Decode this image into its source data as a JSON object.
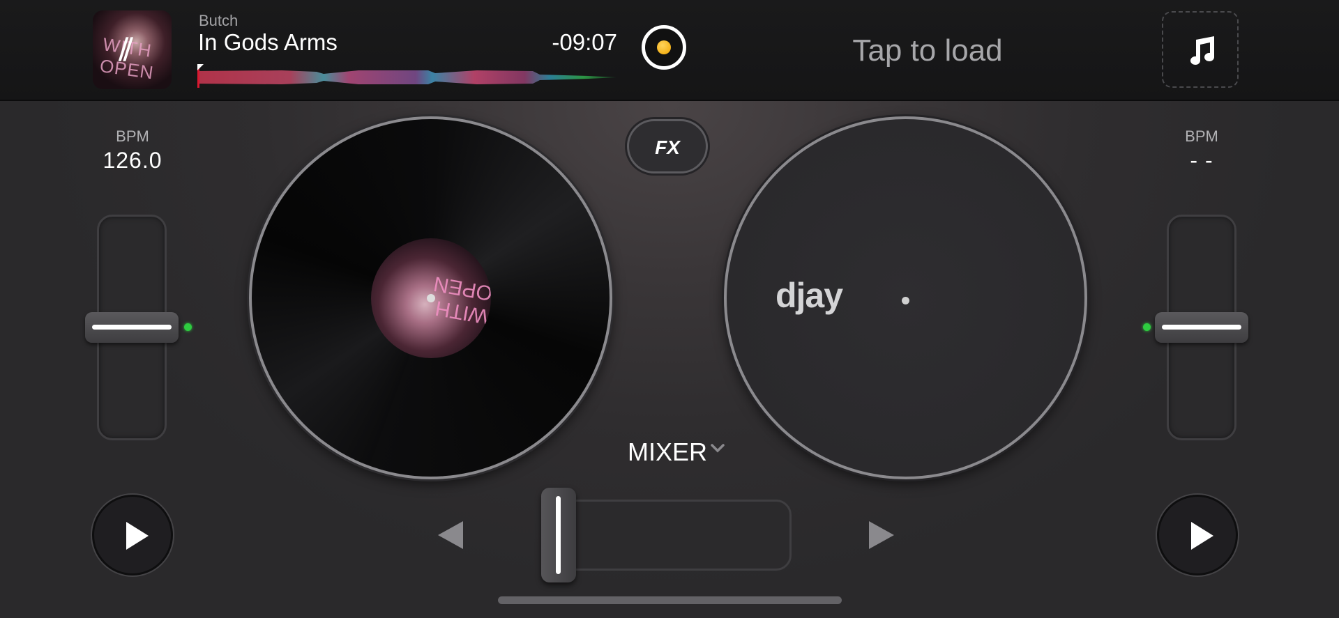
{
  "deck_left": {
    "artist": "Butch",
    "title": "In Gods Arms",
    "time_remaining": "-09:07",
    "bpm_label": "BPM",
    "bpm_value": "126.0",
    "album_art_text": "WITH OPEN",
    "pitch_position": 0.5,
    "playhead_progress": 0.0
  },
  "deck_right": {
    "load_prompt": "Tap to load",
    "bpm_label": "BPM",
    "bpm_value": "- -",
    "logo_text": "djay",
    "pitch_position": 0.5
  },
  "center": {
    "fx_label": "FX",
    "mixer_label": "MIXER",
    "crossfader_position": 0.0
  },
  "colors": {
    "accent_yellow": "#f0a500",
    "playhead_red": "#d9182f",
    "led_green": "#2ecc40"
  },
  "icons": {
    "music_library": "music-note-icon",
    "play": "play-icon",
    "sync": "sync-icon"
  }
}
